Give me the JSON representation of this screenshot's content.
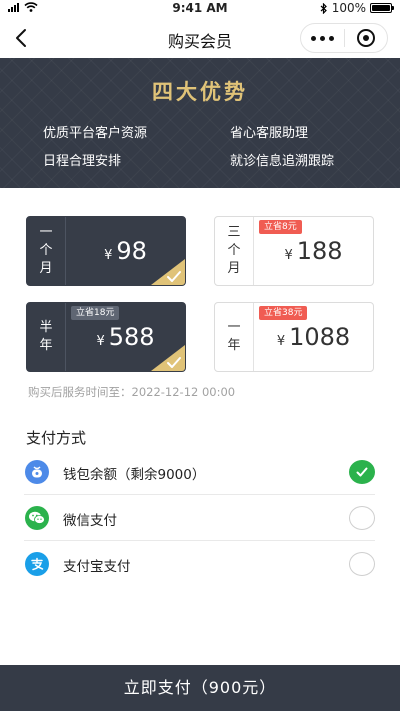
{
  "status_bar": {
    "time": "9:41 AM",
    "battery": "100%",
    "battery_level": 1.0
  },
  "nav": {
    "title": "购买会员"
  },
  "banner": {
    "title": "四大优势",
    "benefits": [
      "优质平台客户资源",
      "省心客服助理",
      "日程合理安排",
      "就诊信息追溯跟踪"
    ]
  },
  "plans": [
    {
      "period": [
        "一",
        "个",
        "月"
      ],
      "currency": "¥",
      "price": "98",
      "badge": "",
      "selected": true
    },
    {
      "period": [
        "三",
        "个",
        "月"
      ],
      "currency": "¥",
      "price": "188",
      "badge": "立省8元",
      "selected": false
    },
    {
      "period": [
        "半",
        "年"
      ],
      "currency": "¥",
      "price": "588",
      "badge": "立省18元",
      "selected": true
    },
    {
      "period": [
        "一",
        "年"
      ],
      "currency": "¥",
      "price": "1088",
      "badge": "立省38元",
      "selected": false
    }
  ],
  "service_time": "购买后服务时间至：2022-12-12 00:00",
  "payment": {
    "title": "支付方式",
    "methods": [
      {
        "label": "钱包余额（剩余9000）",
        "icon": "wallet-icon",
        "color": "#4d8ae8",
        "selected": true
      },
      {
        "label": "微信支付",
        "icon": "wechat-icon",
        "color": "#2bb24c",
        "selected": false
      },
      {
        "label": "支付宝支付",
        "icon": "alipay-icon",
        "color": "#1a9fe8",
        "selected": false
      }
    ]
  },
  "pay_button": "立即支付（900元）",
  "colors": {
    "dark": "#353b47",
    "gold": "#e0c378",
    "badge_red": "#f05c52",
    "success": "#2bb24c"
  }
}
